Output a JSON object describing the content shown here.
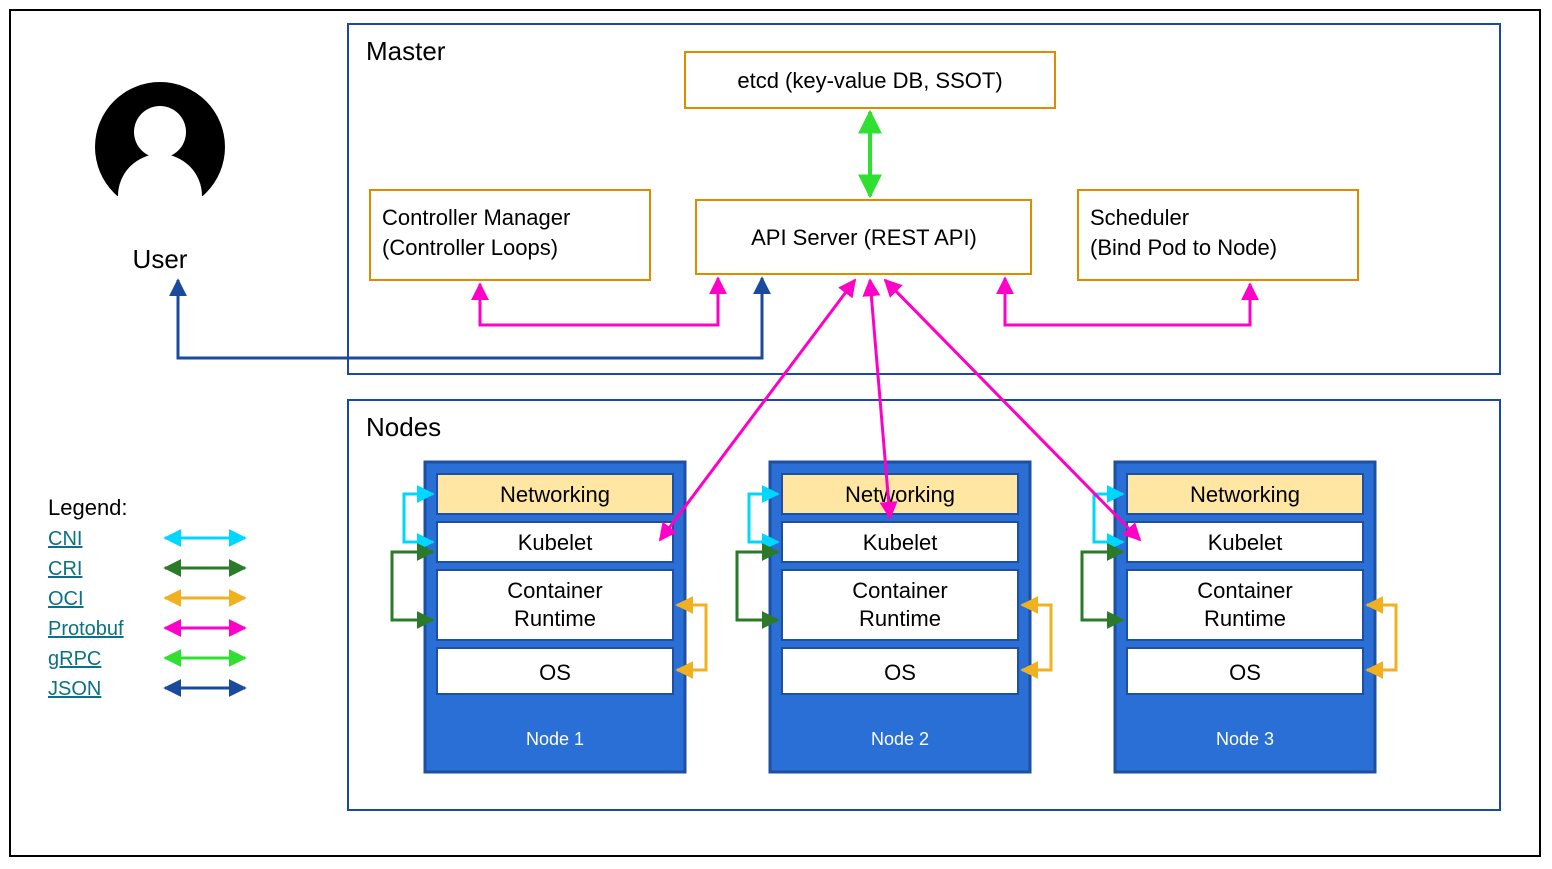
{
  "user_label": "User",
  "master": {
    "title": "Master",
    "etcd": "etcd (key-value DB, SSOT)",
    "controller_line1": "Controller Manager",
    "controller_line2": "(Controller Loops)",
    "api_server": "API Server (REST API)",
    "scheduler_line1": "Scheduler",
    "scheduler_line2": "(Bind Pod to Node)"
  },
  "nodes": {
    "title": "Nodes",
    "layers": {
      "networking": "Networking",
      "kubelet": "Kubelet",
      "runtime_line1": "Container",
      "runtime_line2": "Runtime",
      "os": "OS"
    },
    "labels": [
      "Node 1",
      "Node 2",
      "Node 3"
    ]
  },
  "legend": {
    "title": "Legend:",
    "items": [
      {
        "label": "CNI",
        "color": "#00d7ff"
      },
      {
        "label": "CRI",
        "color": "#2a7a2a"
      },
      {
        "label": "OCI",
        "color": "#f0b020"
      },
      {
        "label": "Protobuf",
        "color": "#ff00c8"
      },
      {
        "label": "gRPC",
        "color": "#30e030"
      },
      {
        "label": "JSON",
        "color": "#1a4a9c"
      }
    ]
  },
  "colors": {
    "border_blue": "#1a4a9c",
    "orange": "#e08a00",
    "node_blue": "#2a6fd6",
    "node_blue_dark": "#1e4fa0",
    "networking_fill": "#ffe7a3"
  }
}
